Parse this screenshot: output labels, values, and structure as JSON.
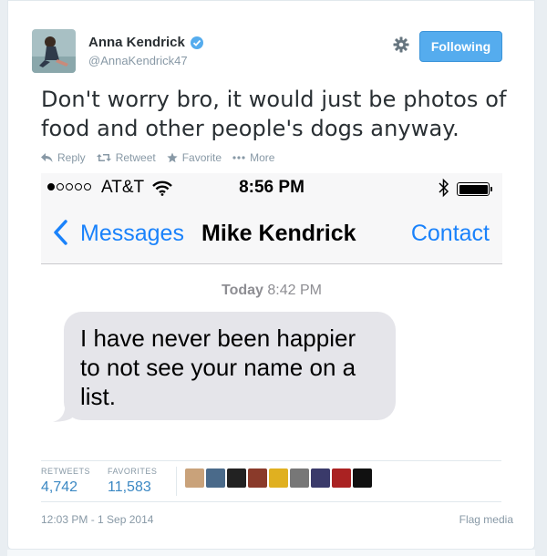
{
  "user": {
    "name": "Anna Kendrick",
    "handle": "@AnnaKendrick47",
    "follow_label": "Following"
  },
  "tweet": {
    "text": "Don't worry bro, it would just be photos of food and other people's dogs anyway."
  },
  "actions": {
    "reply": "Reply",
    "retweet": "Retweet",
    "favorite": "Favorite",
    "more": "More"
  },
  "media": {
    "carrier": "AT&T",
    "time": "8:56 PM",
    "back_label": "Messages",
    "conversation_name": "Mike Kendrick",
    "contact_label": "Contact",
    "today_label": "Today",
    "today_time": "8:42 PM",
    "message": "I have never been happier to not see your name on a list."
  },
  "stats": {
    "retweets_label": "RETWEETS",
    "retweets": "4,742",
    "favorites_label": "FAVORITES",
    "favorites": "11,583"
  },
  "footer": {
    "timestamp": "12:03 PM - 1 Sep 2014",
    "flag": "Flag media"
  },
  "colors": {
    "accent": "#55acee",
    "imessage_blue": "#1a82fb",
    "count_blue": "#3b88c3",
    "muted": "#8899a6"
  },
  "icons": [
    "gear-icon",
    "verified-badge-icon",
    "reply-icon",
    "retweet-icon",
    "star-icon",
    "more-dots-icon",
    "wifi-icon",
    "bluetooth-icon",
    "battery-icon",
    "back-chevron-icon"
  ]
}
